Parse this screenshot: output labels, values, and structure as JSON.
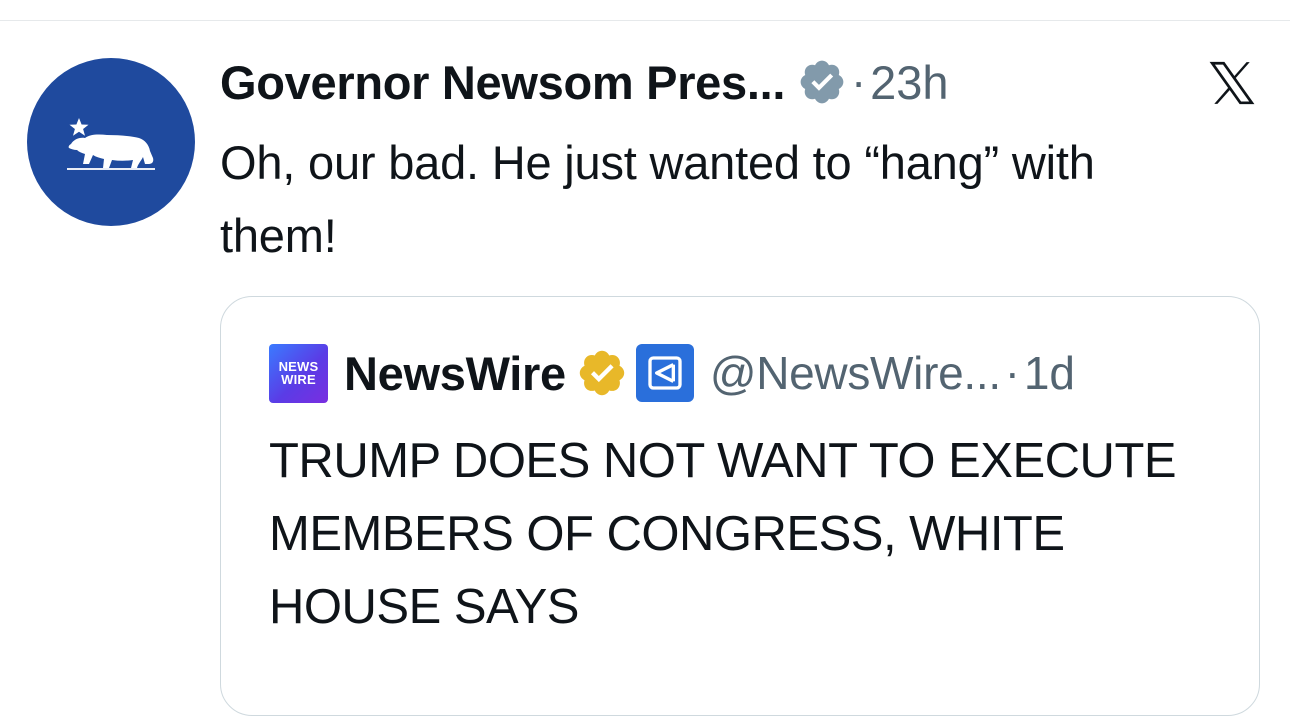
{
  "tweet": {
    "display_name": "Governor Newsom Pres...",
    "verified": true,
    "dot": "·",
    "timestamp": "23h",
    "text": "Oh, our bad. He just wanted to “hang” with them!",
    "avatar_icon": "california-bear-flag-icon",
    "avatar_color": "#1f4a9e"
  },
  "brand": {
    "logo": "x-logo-icon"
  },
  "quoted_tweet": {
    "logo_text_line1": "NEWS",
    "logo_text_line2": "WIRE",
    "display_name": "NewsWire",
    "verified_badge": "gold-verified-icon",
    "affiliate_badge": "affiliate-badge-icon",
    "handle": "@NewsWire...",
    "dot": "·",
    "timestamp": "1d",
    "text": "TRUMP DOES NOT WANT TO EXECUTE MEMBERS OF CONGRESS, WHITE HOUSE SAYS"
  },
  "colors": {
    "text_primary": "#0f1419",
    "text_secondary": "#536471",
    "border": "#cfd9de",
    "verified_gray": "#829aab",
    "verified_gold": "#e8b829"
  }
}
